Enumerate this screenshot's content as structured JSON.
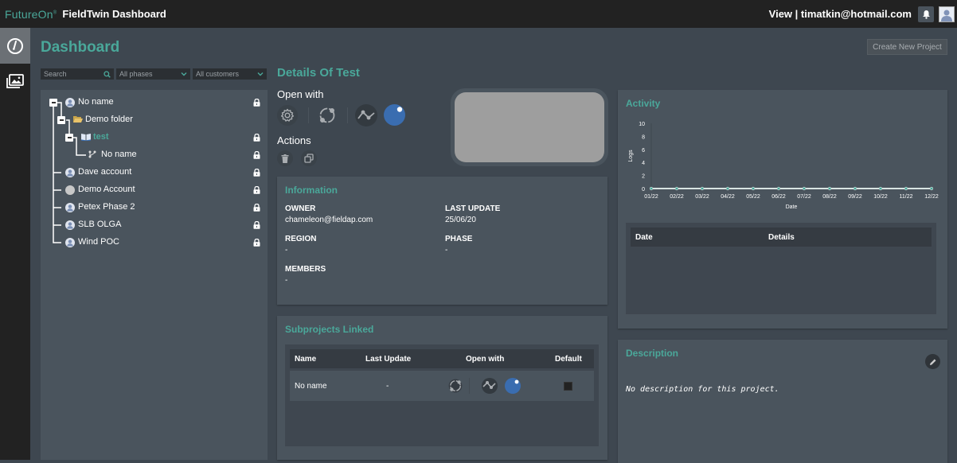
{
  "header": {
    "brand": "FutureOn",
    "app_title": "FieldTwin Dashboard",
    "user_text": "View | timatkin@hotmail.com",
    "icons": [
      "bell-icon",
      "user-avatar-icon"
    ]
  },
  "sidenav": {
    "items": [
      {
        "name": "dashboard",
        "icon": "gauge-icon",
        "active": true
      },
      {
        "name": "gallery",
        "icon": "images-icon",
        "active": false
      }
    ]
  },
  "page": {
    "title": "Dashboard",
    "create_button": "Create New Project"
  },
  "filters": {
    "search_placeholder": "Search",
    "phase_selected": "All phases",
    "customer_selected": "All customers"
  },
  "tree": {
    "items": [
      {
        "label": "No name",
        "level": 0,
        "icon": "account-icon",
        "expander": "-",
        "locked": true,
        "active": false
      },
      {
        "label": "Demo folder",
        "level": 1,
        "icon": "folder-open-icon",
        "expander": "-",
        "locked": false,
        "active": false
      },
      {
        "label": "test",
        "level": 2,
        "icon": "book-icon",
        "expander": "-",
        "locked": true,
        "active": true
      },
      {
        "label": "No name",
        "level": 3,
        "icon": "subproject-branch-icon",
        "expander": "",
        "locked": true,
        "active": false
      },
      {
        "label": "Dave account",
        "level": 0,
        "icon": "account-icon",
        "expander": "",
        "locked": true,
        "active": false
      },
      {
        "label": "Demo Account",
        "level": 0,
        "icon": "demo-logo-icon",
        "expander": "",
        "locked": true,
        "active": false
      },
      {
        "label": "Petex Phase 2",
        "level": 0,
        "icon": "account-icon",
        "expander": "",
        "locked": true,
        "active": false
      },
      {
        "label": "SLB OLGA",
        "level": 0,
        "icon": "account-icon",
        "expander": "",
        "locked": true,
        "active": false
      },
      {
        "label": "Wind POC",
        "level": 0,
        "icon": "account-icon",
        "expander": "",
        "locked": true,
        "active": false
      }
    ]
  },
  "details": {
    "title": "Details Of Test",
    "open_with_label": "Open with",
    "open_with_apps": [
      "settings-icon",
      "cycle-app-icon",
      "line-graph-app-icon",
      "globe-app-icon"
    ],
    "actions_label": "Actions",
    "actions": [
      "delete-icon",
      "duplicate-icon"
    ]
  },
  "information": {
    "title": "Information",
    "owner_label": "OWNER",
    "owner_value": "chameleon@fieldap.com",
    "last_update_label": "LAST UPDATE",
    "last_update_value": "25/06/20",
    "region_label": "REGION",
    "region_value": "-",
    "phase_label": "PHASE",
    "phase_value": "-",
    "members_label": "MEMBERS",
    "members_value": "-"
  },
  "subprojects": {
    "title": "Subprojects Linked",
    "columns": [
      "Name",
      "Last Update",
      "Open with",
      "Default"
    ],
    "rows": [
      {
        "name": "No name",
        "last_update": "-",
        "default": false
      }
    ]
  },
  "activity": {
    "title": "Activity",
    "log_columns": [
      "Date",
      "Details"
    ]
  },
  "chart_data": {
    "type": "line",
    "title": "",
    "xlabel": "Date",
    "ylabel": "Logs",
    "categories": [
      "01/22",
      "02/22",
      "03/22",
      "04/22",
      "05/22",
      "06/22",
      "07/22",
      "08/22",
      "09/22",
      "10/22",
      "11/22",
      "12/22"
    ],
    "series": [
      {
        "name": "Logs",
        "values": [
          0,
          0,
          0,
          0,
          0,
          0,
          0,
          0,
          0,
          0,
          0,
          0
        ]
      }
    ],
    "yticks": [
      0,
      2,
      4,
      6,
      8,
      10
    ],
    "ylim": [
      0,
      10
    ],
    "grid": false,
    "legend": "none",
    "colors": {
      "line": "#4aa89a",
      "text": "#ffffff"
    }
  },
  "description": {
    "title": "Description",
    "text": "No description for this project."
  },
  "colors": {
    "accent": "#4aa89a",
    "globe_app": "#3a6db0",
    "topbar": "#222222",
    "panel": "#4a545d",
    "background": "#3e4750"
  }
}
